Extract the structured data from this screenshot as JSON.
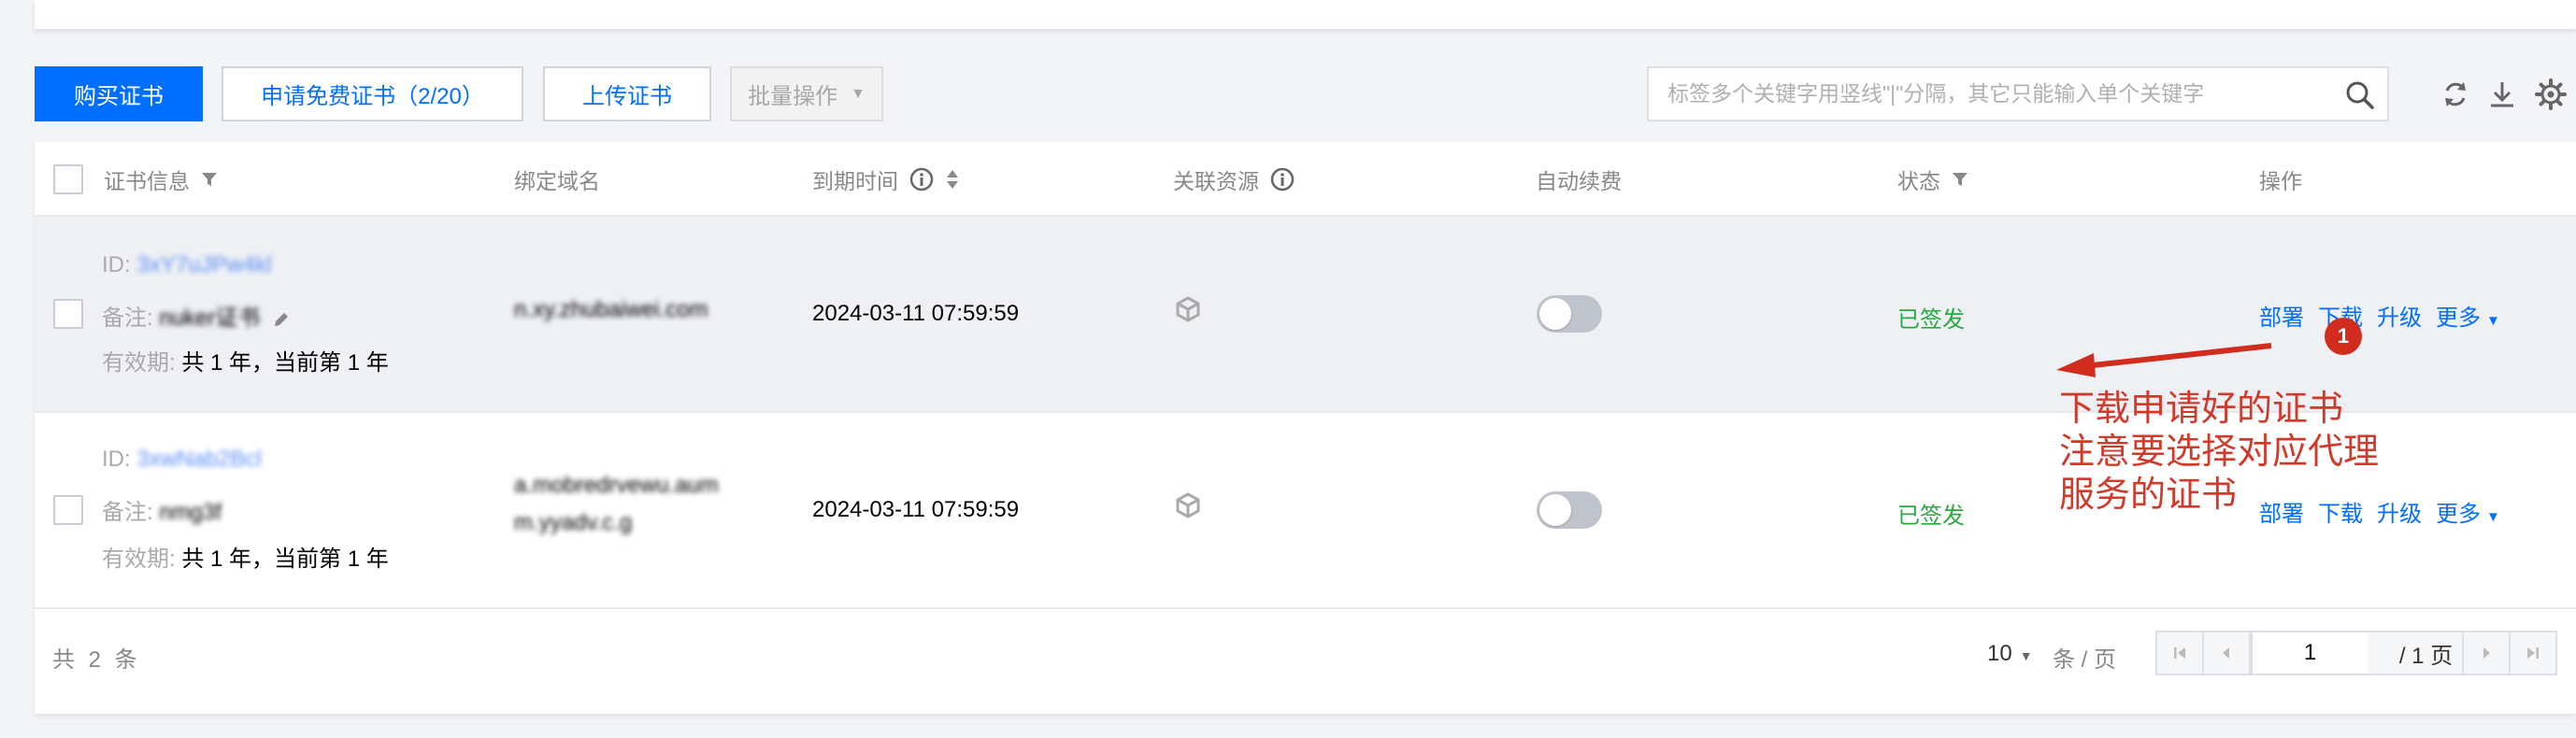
{
  "toolbar": {
    "buy_label": "购买证书",
    "apply_free_label": "申请免费证书（2/20）",
    "upload_label": "上传证书",
    "batch_label": "批量操作"
  },
  "search": {
    "placeholder": "标签多个关键字用竖线\"|\"分隔，其它只能输入单个关键字"
  },
  "table": {
    "columns": {
      "cert_info": "证书信息",
      "domain": "绑定域名",
      "expire": "到期时间",
      "resource": "关联资源",
      "auto_renew": "自动续费",
      "status": "状态",
      "actions": "操作"
    },
    "rows": [
      {
        "id_label": "ID:",
        "id_value": "3xY7uJPw4kl",
        "remark_label": "备注:",
        "remark_value": "nuker证书",
        "validity_label": "有效期:",
        "validity_value": "共 1 年，当前第 1 年",
        "domain_line1": "n.xy.zhubaiwei.com",
        "domain_line2": "",
        "expire_time": "2024-03-11 07:59:59",
        "auto_renew": false,
        "status": "已签发",
        "actions": {
          "deploy": "部署",
          "download": "下载",
          "upgrade": "升级",
          "more": "更多"
        }
      },
      {
        "id_label": "ID:",
        "id_value": "3xwNab2Bcl",
        "remark_label": "备注:",
        "remark_value": "nmg3f",
        "validity_label": "有效期:",
        "validity_value": "共 1 年，当前第 1 年",
        "domain_line1": "a.mobredrvewu.aum",
        "domain_line2": "m.yyadv.c.g",
        "expire_time": "2024-03-11 07:59:59",
        "auto_renew": false,
        "status": "已签发",
        "actions": {
          "deploy": "部署",
          "download": "下载",
          "upgrade": "升级",
          "more": "更多"
        }
      }
    ]
  },
  "footer": {
    "total": "共 2 条",
    "page_size": "10",
    "page_size_unit": "条 / 页",
    "current_page": "1",
    "page_total": "/ 1 页"
  },
  "annotation": {
    "badge": "1",
    "line1": "下载申请好的证书",
    "line2": "注意要选择对应代理",
    "line3": "服务的证书"
  },
  "colors": {
    "primary": "#006eff",
    "success": "#29a93f",
    "annotation": "#d03a2b"
  }
}
